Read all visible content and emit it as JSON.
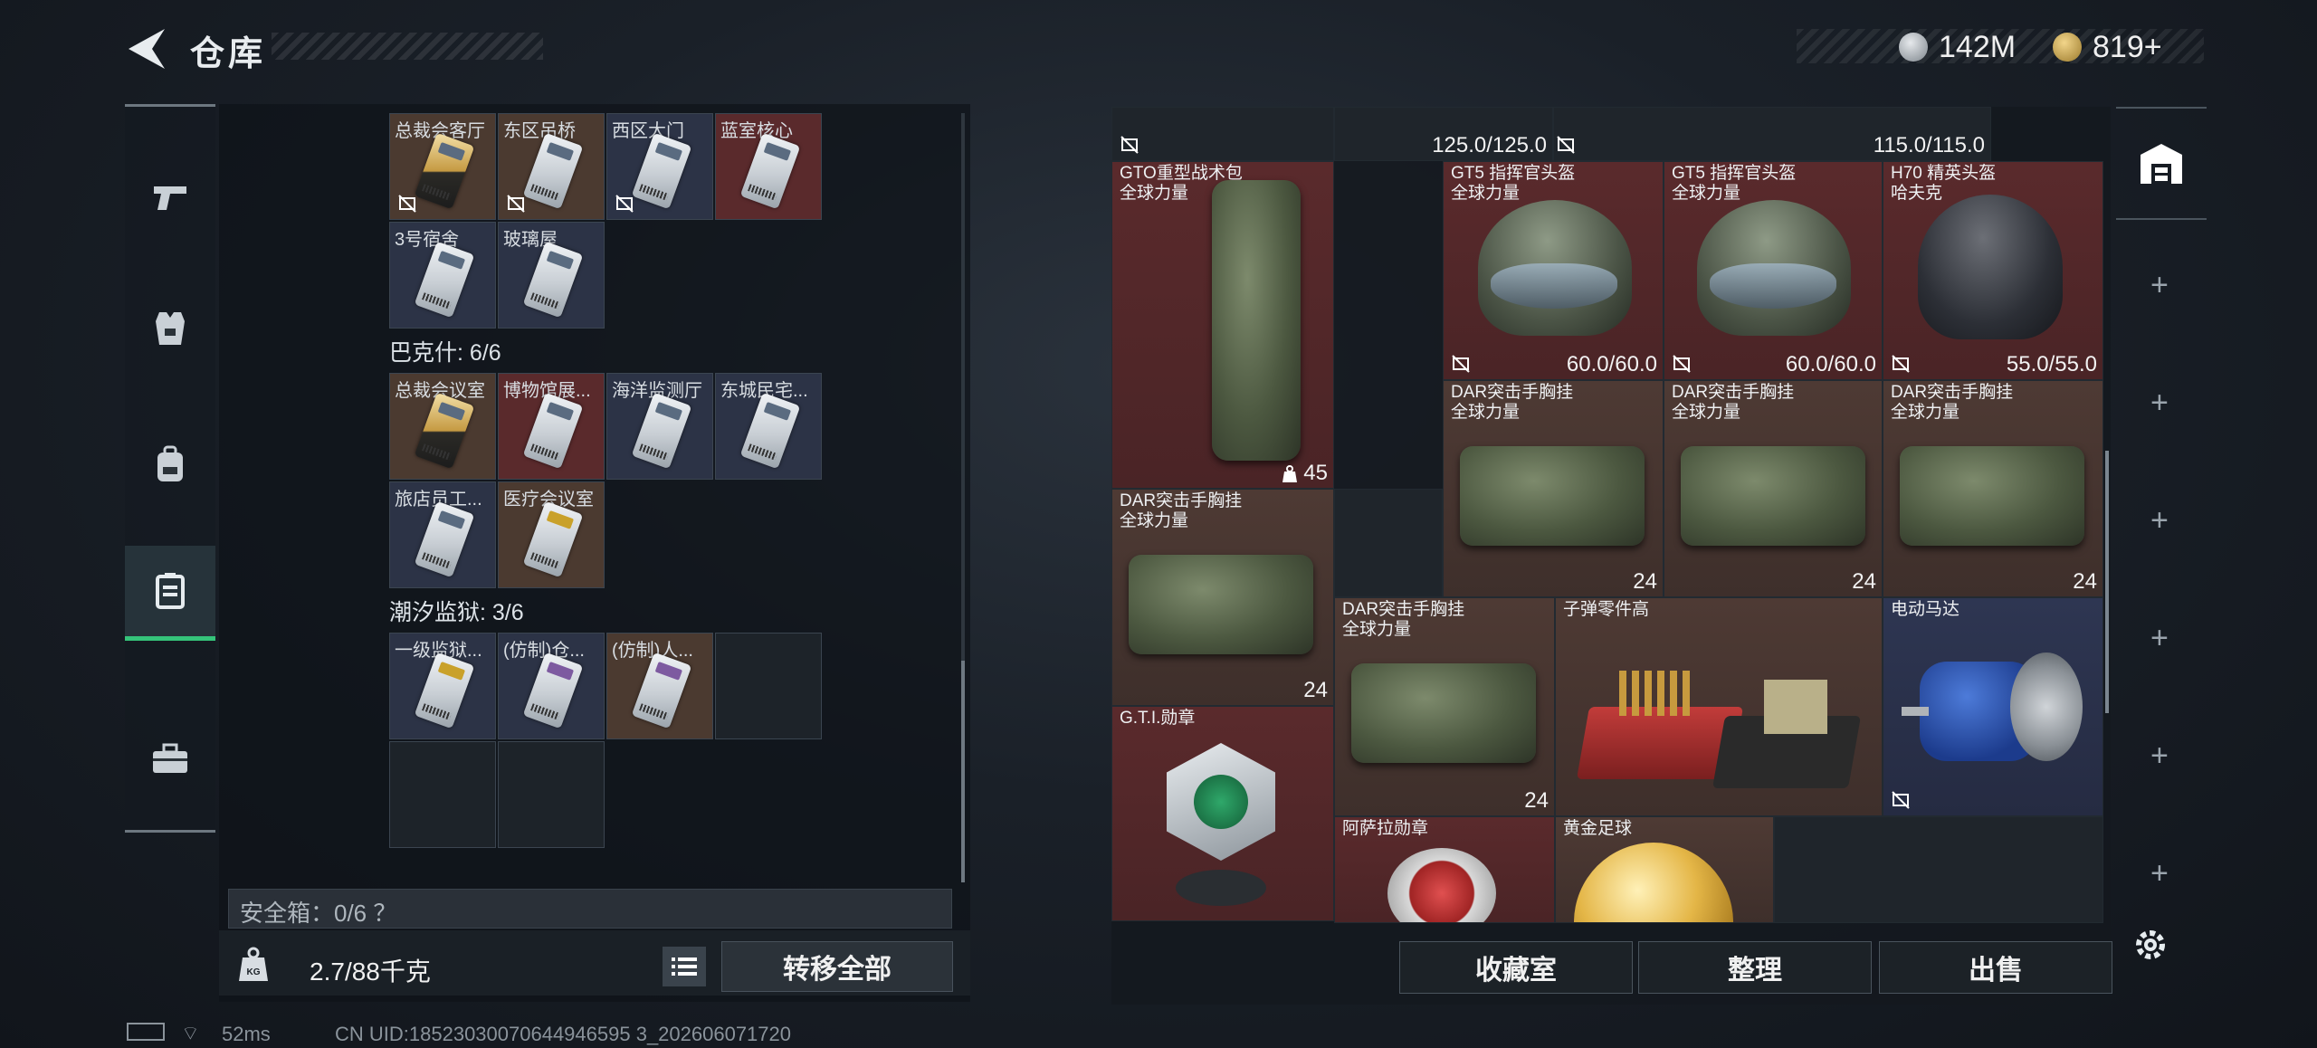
{
  "header": {
    "title": "仓库",
    "currency1": "142M",
    "currency2": "819+"
  },
  "left": {
    "cards_row1": [
      "总裁会客厅",
      "东区吊桥",
      "西区大门",
      "蓝室核心"
    ],
    "cards_row2": [
      "3号宿舍",
      "玻璃屋"
    ],
    "section2_title": "巴克什: 6/6",
    "cards_row3": [
      "总裁会议室",
      "博物馆展...",
      "海洋监测厅",
      "东城民宅..."
    ],
    "cards_row4": [
      "旅店员工...",
      "医疗会议室"
    ],
    "section3_title": "潮汐监狱: 3/6",
    "cards_row5": [
      "一级监狱...",
      "(仿制)仓...",
      "(仿制)人..."
    ],
    "safe_box": "安全箱：0/6 ？",
    "weight_value": "2.7",
    "weight_total": "/88千克",
    "move_all": "转移全部",
    "kg_label": "KG"
  },
  "right": {
    "top_values": [
      "125.0/125.0",
      "115.0/115.0"
    ],
    "items": {
      "backpack": {
        "name": "GTO重型战术包",
        "sub": "全球力量",
        "val": "45"
      },
      "helmet1": {
        "name": "GT5 指挥官头盔",
        "sub": "全球力量",
        "val": "60.0/60.0"
      },
      "helmet2": {
        "name": "GT5 指挥官头盔",
        "sub": "全球力量",
        "val": "60.0/60.0"
      },
      "helmet3": {
        "name": "H70 精英头盔",
        "sub": "哈夫克",
        "val": "55.0/55.0"
      },
      "vest1": {
        "name": "DAR突击手胸挂",
        "sub": "全球力量",
        "val": "24"
      },
      "vest2": {
        "name": "DAR突击手胸挂",
        "sub": "全球力量",
        "val": "24"
      },
      "vest3": {
        "name": "DAR突击手胸挂",
        "sub": "全球力量",
        "val": "24"
      },
      "vest4": {
        "name": "DAR突击手胸挂",
        "sub": "全球力量",
        "val": "24"
      },
      "vest5": {
        "name": "DAR突击手胸挂",
        "sub": "全球力量",
        "val": "24"
      },
      "ammo_parts": {
        "name": "子弹零件高"
      },
      "motor": {
        "name": "电动马达"
      },
      "gti_medal": {
        "name": "G.T.I.勋章"
      },
      "asala_medal": {
        "name": "阿萨拉勋章"
      },
      "gold_ball": {
        "name": "黄金足球"
      }
    },
    "buttons": [
      "收藏室",
      "整理",
      "出售"
    ]
  },
  "status": {
    "ping": "52ms",
    "uid": "CN UID:18523030070644946595 3_202606071720"
  }
}
